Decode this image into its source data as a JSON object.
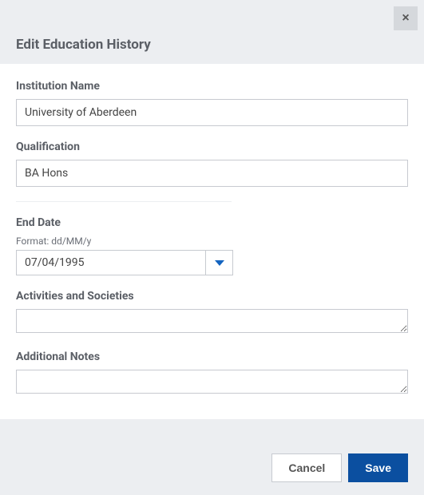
{
  "dialog": {
    "title": "Edit Education History"
  },
  "fields": {
    "institution": {
      "label": "Institution Name",
      "value": "University of Aberdeen"
    },
    "qualification": {
      "label": "Qualification",
      "value": "BA Hons"
    },
    "endDate": {
      "label": "End Date",
      "hint": "Format: dd/MM/y",
      "value": "07/04/1995"
    },
    "activities": {
      "label": "Activities and Societies",
      "value": ""
    },
    "notes": {
      "label": "Additional Notes",
      "value": ""
    }
  },
  "buttons": {
    "cancel": "Cancel",
    "save": "Save",
    "close": "×"
  }
}
